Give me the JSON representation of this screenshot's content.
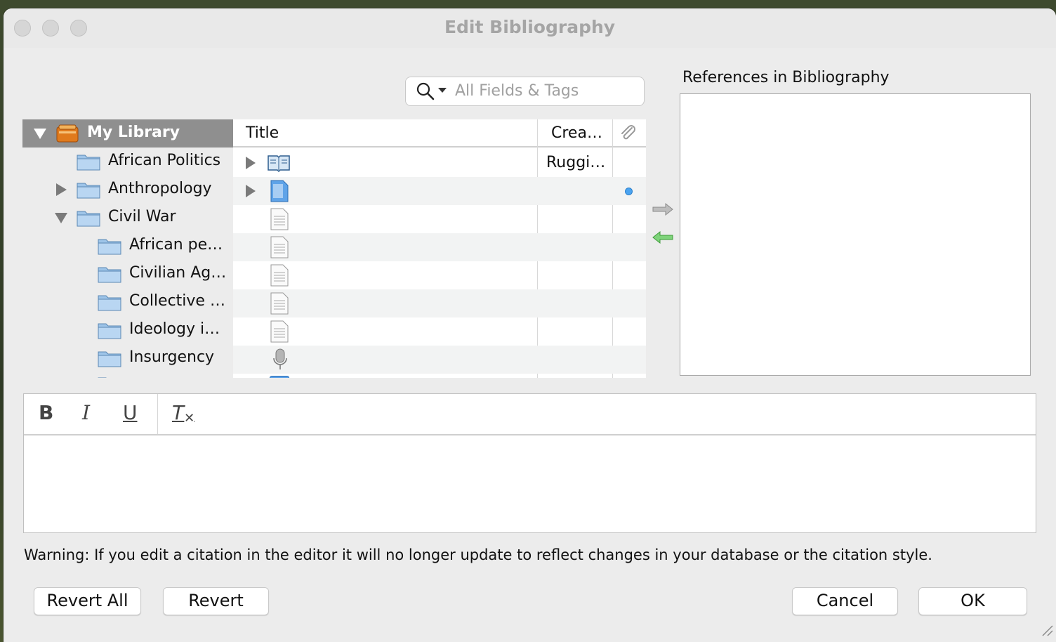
{
  "window": {
    "title": "Edit Bibliography"
  },
  "search": {
    "placeholder": "All Fields & Tags"
  },
  "references": {
    "label": "References in Bibliography"
  },
  "tree": {
    "root": "My Library",
    "items": [
      {
        "label": "African Politics"
      },
      {
        "label": "Anthropology"
      },
      {
        "label": "Civil War"
      },
      {
        "label": "African pe…"
      },
      {
        "label": "Civilian Ag…"
      },
      {
        "label": "Collective …"
      },
      {
        "label": "Ideology i…"
      },
      {
        "label": "Insurgency"
      }
    ]
  },
  "table": {
    "columns": {
      "title": "Title",
      "creator": "Crea…"
    },
    "rows": [
      {
        "creator": "Ruggi…"
      },
      {
        "creator": ""
      }
    ]
  },
  "format_toolbar": {
    "bold": "B",
    "italic": "I",
    "underline": "U",
    "clear": "T"
  },
  "warning": "Warning: If you edit a citation in the editor it will no longer update to reflect changes in your database or the citation style.",
  "buttons": {
    "revert_all": "Revert All",
    "revert": "Revert",
    "cancel": "Cancel",
    "ok": "OK"
  }
}
